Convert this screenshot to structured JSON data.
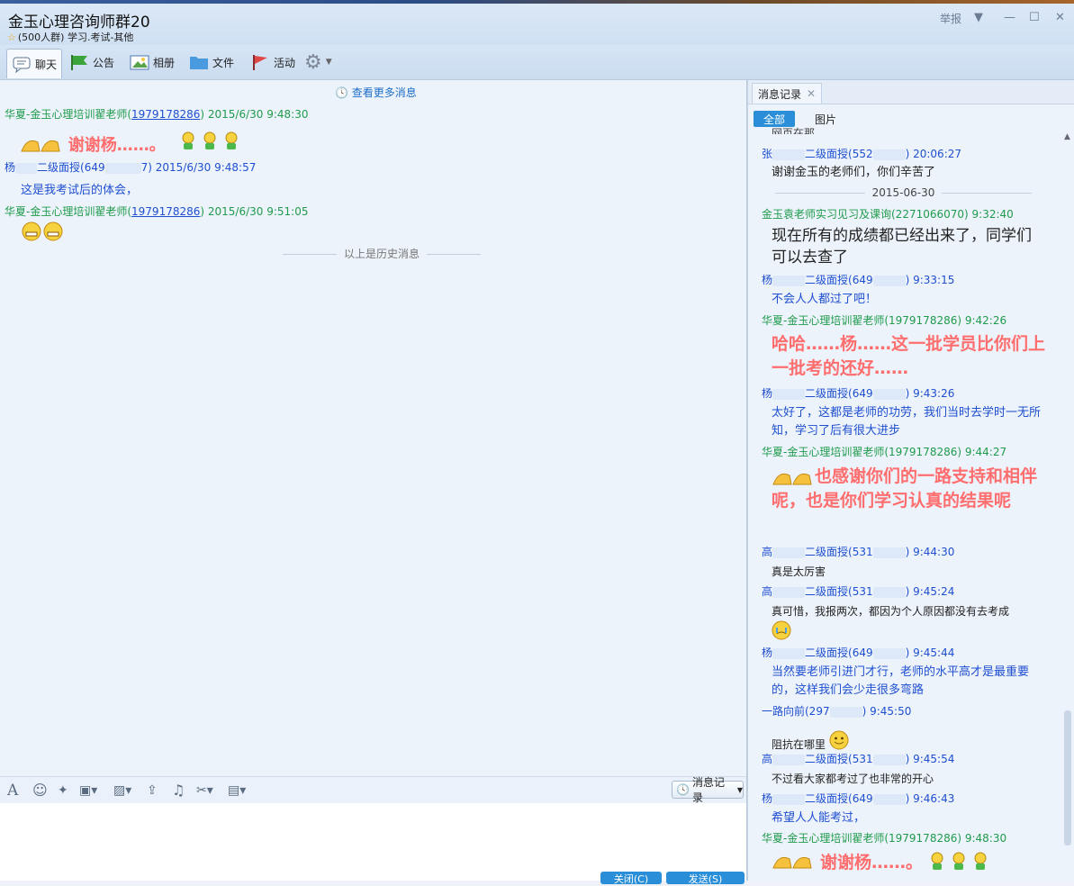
{
  "window": {
    "title": "金玉心理咨询师群20",
    "subtitle": "(500人群) 学习.考试-其他",
    "report": "举报"
  },
  "tabs": {
    "chat": "聊天",
    "notice": "公告",
    "album": "相册",
    "files": "文件",
    "activity": "活动"
  },
  "chat": {
    "more_link": "查看更多消息",
    "history_sep": "以上是历史消息",
    "m1_name": "华夏-金玉心理培训翟老师",
    "m1_qq": "1979178286",
    "m1_time": "2015/6/30 9:48:30",
    "m1_text": "谢谢杨……。",
    "m2_name": "杨",
    "m2_group": "二级面授(649",
    "m2_qq_end": "7)",
    "m2_time": "2015/6/30 9:48:57",
    "m2_text": "这是我考试后的体会，",
    "m3_name": "华夏-金玉心理培训翟老师",
    "m3_qq": "1979178286",
    "m3_time": "2015/6/30 9:51:05"
  },
  "input": {
    "history_button": "消息记录",
    "close_button": "关闭(C)",
    "send_button": "发送(S)"
  },
  "history": {
    "tab_label": "消息记录",
    "filter_all": "全部",
    "filter_images": "图片",
    "cut_text": "网页在那",
    "r1_head": "张",
    "r1_group": "二级面授(552",
    "r1_time": ") 20:06:27",
    "r1_text": "谢谢金玉的老师们，你们辛苦了",
    "date_sep": "2015-06-30",
    "r2_head": "金玉袁老师实习见习及课询(2271066070) 9:32:40",
    "r2_text": "现在所有的成绩都已经出来了，同学们可以去查了",
    "r3_head": "杨",
    "r3_group": "二级面授(649",
    "r3_time": ") 9:33:15",
    "r3_text": "不会人人都过了吧！",
    "r4_head": "华夏-金玉心理培训翟老师(1979178286) 9:42:26",
    "r4_text": "哈哈……杨……这一批学员比你们上一批考的还好……",
    "r5_head": "杨",
    "r5_group": "二级面授(649",
    "r5_time": ") 9:43:26",
    "r5_text": "太好了，这都是老师的功劳，我们当时去学时一无所知，学习了后有很大进步",
    "r6_head": "华夏-金玉心理培训翟老师(1979178286) 9:44:27",
    "r6_text": "也感谢你们的一路支持和相伴呢，也是你们学习认真的结果呢",
    "r7_head": "高",
    "r7_group": "二级面授(531",
    "r7_time": ") 9:44:30",
    "r7_text": "真是太厉害",
    "r8_head": "高",
    "r8_group": "二级面授(531",
    "r8_time": ") 9:45:24",
    "r8_text": "真可惜，我报两次，都因为个人原因都没有去考成",
    "r9_head": "杨",
    "r9_group": "二级面授(649",
    "r9_time": ") 9:45:44",
    "r9_text": "当然要老师引进门才行，老师的水平高才是最重要的，这样我们会少走很多弯路",
    "r10_head": "一路向前(297",
    "r10_time": ") 9:45:50",
    "r10_text": "阻抗在哪里",
    "r11_head": "高",
    "r11_group": "二级面授(531",
    "r11_time": ") 9:45:54",
    "r11_text": "不过看大家都考过了也非常的开心",
    "r12_head": "杨",
    "r12_group": "二级面授(649",
    "r12_time": ") 9:46:43",
    "r12_text": "希望人人能考过，",
    "r13_head": "华夏-金玉心理培训翟老师(1979178286) 9:48:30",
    "r13_text": "谢谢杨……。"
  },
  "colors": {
    "green_name": "#1f9b4b",
    "blue_name": "#1e4fd0",
    "pink_text": "#ff6e6e",
    "accent": "#2a8ed8"
  }
}
